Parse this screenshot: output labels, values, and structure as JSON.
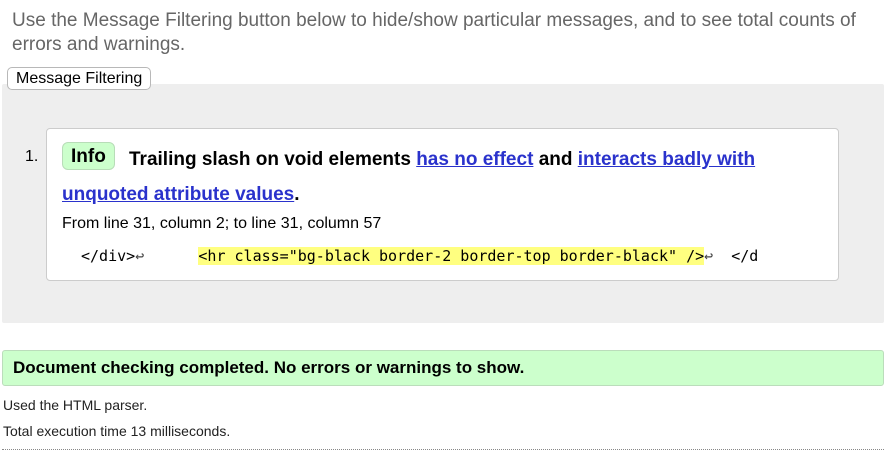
{
  "intro": {
    "text": "Use the Message Filtering button below to hide/show particular messages, and to see total counts of errors and warnings."
  },
  "filter_button": {
    "label": "Message Filtering"
  },
  "messages": [
    {
      "number": "1.",
      "type": "Info",
      "text_1": "Trailing slash on void elements",
      "link_1": "has no effect",
      "text_2": "and",
      "link_2": "interacts badly with unquoted attribute values",
      "text_3": ".",
      "location": "From line 31, column 2; to line 31, column 57",
      "extract": {
        "before": "</div>",
        "highlight": "<hr class=\"bg-black border-2 border-top border-black\" />",
        "after": "</d",
        "line_feed_glyph": "↩"
      }
    }
  ],
  "status": {
    "message": "Document checking completed. No errors or warnings to show."
  },
  "footer": {
    "parser": "Used the HTML parser.",
    "execution_time": "Total execution time 13 milliseconds."
  },
  "colors": {
    "info_badge_bg": "#ccffcc",
    "link": "#2a32cc",
    "highlight": "#ffff80",
    "success_bg": "#ccffcc",
    "panel_bg": "#eeeeee"
  }
}
